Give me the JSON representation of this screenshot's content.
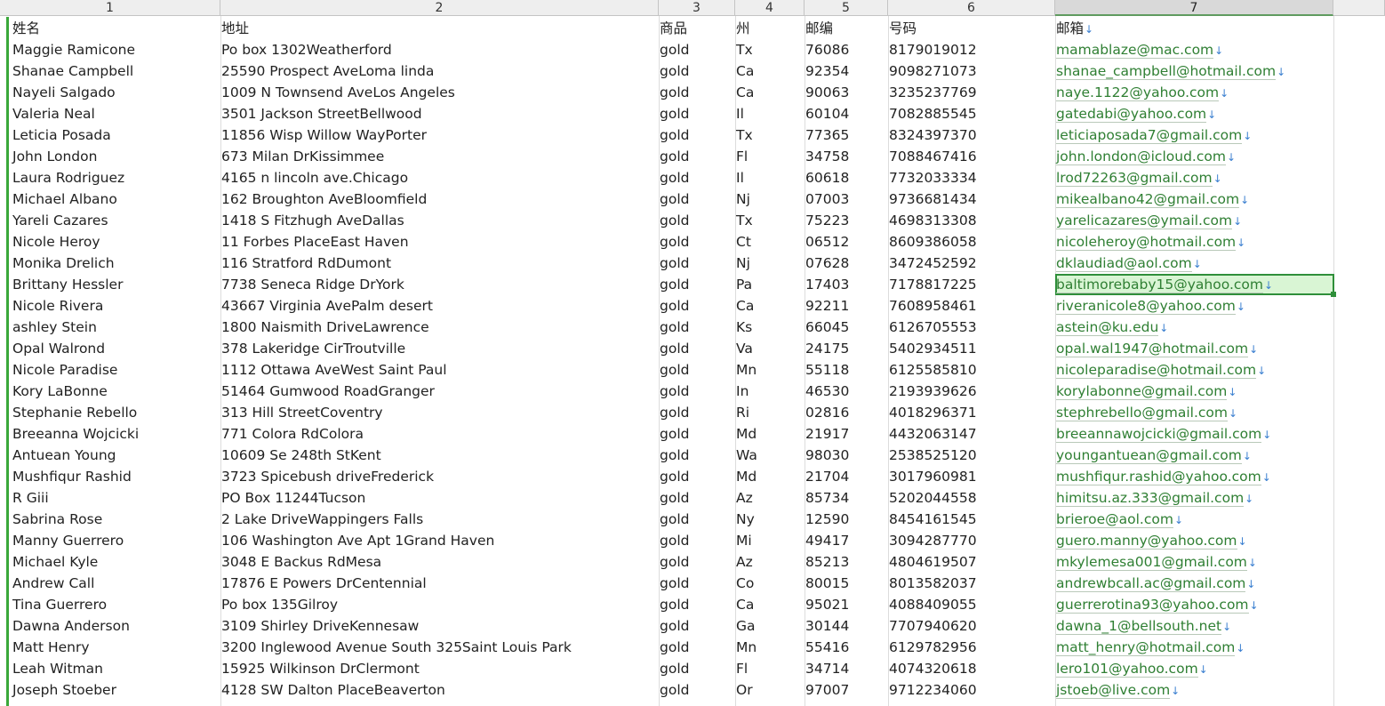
{
  "sheet": {
    "column_numbers": [
      "1",
      "2",
      "3",
      "4",
      "5",
      "6",
      "7"
    ],
    "headers": [
      "姓名",
      "地址",
      "商品",
      "州",
      "邮编",
      "号码",
      "邮箱"
    ],
    "header_arrow": "↓",
    "active_column": "7",
    "selected_cell": "baltimorebaby15@yahoo.com",
    "rows": [
      [
        "Maggie Ramicone",
        "Po box 1302Weatherford",
        "gold",
        "Tx",
        "76086",
        "8179019012",
        "mamablaze@mac.com"
      ],
      [
        "Shanae Campbell",
        "25590 Prospect AveLoma linda",
        "gold",
        "Ca",
        "92354",
        "9098271073",
        "shanae_campbell@hotmail.com"
      ],
      [
        "Nayeli Salgado",
        "1009 N Townsend AveLos Angeles",
        "gold",
        "Ca",
        "90063",
        "3235237769",
        "naye.1122@yahoo.com"
      ],
      [
        "Valeria Neal",
        "3501 Jackson StreetBellwood",
        "gold",
        "Il",
        "60104",
        "7082885545",
        "gatedabi@yahoo.com"
      ],
      [
        "Leticia Posada",
        "11856 Wisp Willow WayPorter",
        "gold",
        "Tx",
        "77365",
        "8324397370",
        "leticiaposada7@gmail.com"
      ],
      [
        "John London",
        "673 Milan DrKissimmee",
        "gold",
        "Fl",
        "34758",
        "7088467416",
        "john.london@icloud.com"
      ],
      [
        "Laura Rodriguez",
        "4165 n lincoln ave.Chicago",
        "gold",
        "Il",
        "60618",
        "7732033334",
        "lrod72263@gmail.com"
      ],
      [
        "Michael Albano",
        "162 Broughton AveBloomfield",
        "gold",
        "Nj",
        "07003",
        "9736681434",
        "mikealbano42@gmail.com"
      ],
      [
        "Yareli Cazares",
        "1418 S Fitzhugh AveDallas",
        "gold",
        "Tx",
        "75223",
        "4698313308",
        "yarelicazares@ymail.com"
      ],
      [
        "Nicole Heroy",
        "11 Forbes PlaceEast Haven",
        "gold",
        "Ct",
        "06512",
        "8609386058",
        "nicoleheroy@hotmail.com"
      ],
      [
        "Monika Drelich",
        "116 Stratford RdDumont",
        "gold",
        "Nj",
        "07628",
        "3472452592",
        "dklaudiad@aol.com"
      ],
      [
        "Brittany Hessler",
        "7738 Seneca Ridge DrYork",
        "gold",
        "Pa",
        "17403",
        "7178817225",
        "baltimorebaby15@yahoo.com"
      ],
      [
        "Nicole Rivera",
        "43667 Virginia AvePalm desert",
        "gold",
        "Ca",
        "92211",
        "7608958461",
        "riveranicole8@yahoo.com"
      ],
      [
        "ashley Stein",
        "1800 Naismith DriveLawrence",
        "gold",
        "Ks",
        "66045",
        "6126705553",
        "astein@ku.edu"
      ],
      [
        "Opal Walrond",
        "378 Lakeridge CirTroutville",
        "gold",
        "Va",
        "24175",
        "5402934511",
        "opal.wal1947@hotmail.com"
      ],
      [
        "Nicole Paradise",
        "1112 Ottawa AveWest Saint Paul",
        "gold",
        "Mn",
        "55118",
        "6125585810",
        "nicoleparadise@hotmail.com"
      ],
      [
        "Kory LaBonne",
        "51464 Gumwood RoadGranger",
        "gold",
        "In",
        "46530",
        "2193939626",
        "korylabonne@gmail.com"
      ],
      [
        "Stephanie Rebello",
        "313 Hill StreetCoventry",
        "gold",
        "Ri",
        "02816",
        "4018296371",
        "stephrebello@gmail.com"
      ],
      [
        "Breeanna Wojcicki",
        "771 Colora RdColora",
        "gold",
        "Md",
        "21917",
        "4432063147",
        "breeannawojcicki@gmail.com"
      ],
      [
        "Antuean Young",
        "10609 Se 248th StKent",
        "gold",
        "Wa",
        "98030",
        "2538525120",
        "youngantuean@gmail.com"
      ],
      [
        "Mushfiqur Rashid",
        "3723 Spicebush driveFrederick",
        "gold",
        "Md",
        "21704",
        "3017960981",
        "mushfiqur.rashid@yahoo.com"
      ],
      [
        "R Giii",
        "PO Box 11244Tucson",
        "gold",
        "Az",
        "85734",
        "5202044558",
        "himitsu.az.333@gmail.com"
      ],
      [
        "Sabrina Rose",
        "2 Lake DriveWappingers Falls",
        "gold",
        "Ny",
        "12590",
        "8454161545",
        "brieroe@aol.com"
      ],
      [
        "Manny Guerrero",
        "106 Washington Ave Apt 1Grand Haven",
        "gold",
        "Mi",
        "49417",
        "3094287770",
        "guero.manny@yahoo.com"
      ],
      [
        "Michael Kyle",
        "3048 E Backus RdMesa",
        "gold",
        "Az",
        "85213",
        "4804619507",
        "mkylemesa001@gmail.com"
      ],
      [
        "Andrew Call",
        "17876 E Powers DrCentennial",
        "gold",
        "Co",
        "80015",
        "8013582037",
        "andrewbcall.ac@gmail.com"
      ],
      [
        "Tina Guerrero",
        "Po box 135Gilroy",
        "gold",
        "Ca",
        "95021",
        "4088409055",
        "guerrerotina93@yahoo.com"
      ],
      [
        "Dawna Anderson",
        "3109 Shirley DriveKennesaw",
        "gold",
        "Ga",
        "30144",
        "7707940620",
        "dawna_1@bellsouth.net"
      ],
      [
        "Matt Henry",
        "3200 Inglewood Avenue South 325Saint Louis Park",
        "gold",
        "Mn",
        "55416",
        "6129782956",
        "matt_henry@hotmail.com"
      ],
      [
        "Leah Witman",
        "15925 Wilkinson DrClermont",
        "gold",
        "Fl",
        "34714",
        "4074320618",
        "lero101@yahoo.com"
      ],
      [
        "Joseph Stoeber",
        "4128 SW Dalton PlaceBeaverton",
        "gold",
        "Or",
        "97007",
        "9712234060",
        "jstoeb@live.com"
      ]
    ]
  }
}
